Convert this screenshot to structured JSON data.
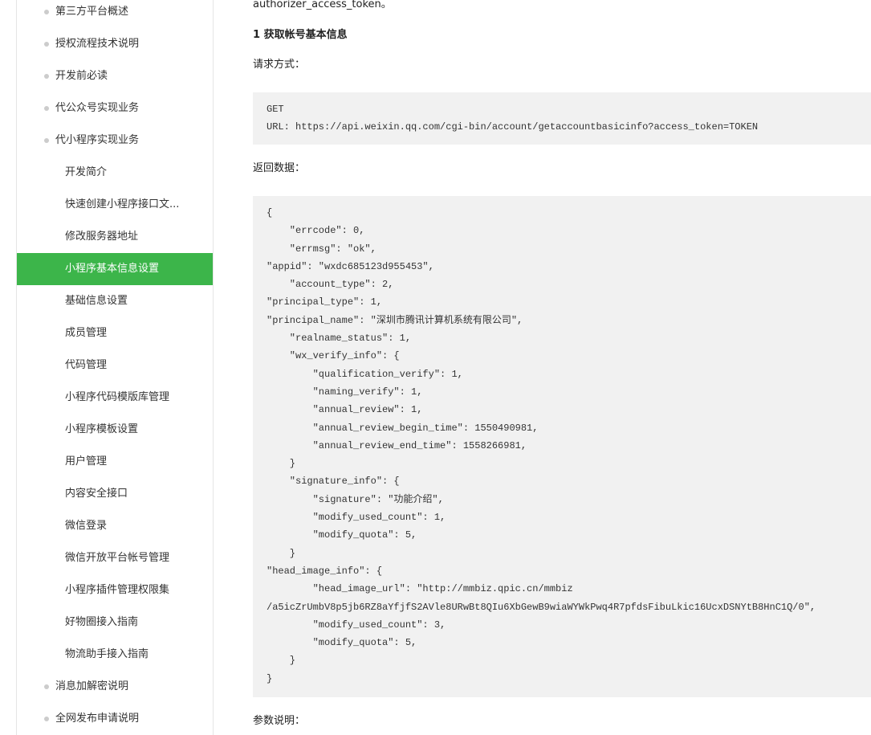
{
  "sidebar": {
    "items": [
      {
        "label": "第三方平台概述",
        "level": "top"
      },
      {
        "label": "授权流程技术说明",
        "level": "top"
      },
      {
        "label": "开发前必读",
        "level": "top"
      },
      {
        "label": "代公众号实现业务",
        "level": "top"
      },
      {
        "label": "代小程序实现业务",
        "level": "top"
      },
      {
        "label": "开发简介",
        "level": "sub"
      },
      {
        "label": "快速创建小程序接口文...",
        "level": "sub"
      },
      {
        "label": "修改服务器地址",
        "level": "sub"
      },
      {
        "label": "小程序基本信息设置",
        "level": "sub",
        "active": true
      },
      {
        "label": "基础信息设置",
        "level": "sub"
      },
      {
        "label": "成员管理",
        "level": "sub"
      },
      {
        "label": "代码管理",
        "level": "sub"
      },
      {
        "label": "小程序代码模版库管理",
        "level": "sub"
      },
      {
        "label": "小程序模板设置",
        "level": "sub"
      },
      {
        "label": "用户管理",
        "level": "sub"
      },
      {
        "label": "内容安全接口",
        "level": "sub"
      },
      {
        "label": "微信登录",
        "level": "sub"
      },
      {
        "label": "微信开放平台帐号管理",
        "level": "sub"
      },
      {
        "label": "小程序插件管理权限集",
        "level": "sub"
      },
      {
        "label": "好物圈接入指南",
        "level": "sub"
      },
      {
        "label": "物流助手接入指南",
        "level": "sub"
      },
      {
        "label": "消息加解密说明",
        "level": "top"
      },
      {
        "label": "全网发布申请说明",
        "level": "top"
      }
    ]
  },
  "content": {
    "intro_tail": "authorizer_access_token。",
    "section_title": "1 获取帐号基本信息",
    "request_label": "请求方式：",
    "request_lines": [
      "GET",
      "URL: https://api.weixin.qq.com/cgi-bin/account/getaccountbasicinfo?access_token=TOKEN"
    ],
    "response_label": "返回数据：",
    "response_lines": [
      "{",
      "    ″errcode″: 0,",
      "    ″errmsg″: ″ok″,",
      "″appid″: ″wxdc685123d955453″,",
      "    ″account_type″: 2,",
      "″principal_type″: 1,",
      "″principal_name″: ″深圳市腾讯计算机系统有限公司″,",
      "    ″realname_status″: 1,",
      "    ″wx_verify_info″: {",
      "        ″qualification_verify″: 1,",
      "        ″naming_verify″: 1,",
      "        ″annual_review″: 1,",
      "        ″annual_review_begin_time″: 1550490981,",
      "        ″annual_review_end_time″: 1558266981,",
      "    }",
      "    ″signature_info″: {",
      "        ″signature″: ″功能介绍″,",
      "        ″modify_used_count″: 1,",
      "        ″modify_quota″: 5,",
      "    }",
      "″head_image_info″: {",
      "        ″head_image_url″: ″http://mmbiz.qpic.cn/mmbiz",
      "/a5icZrUmbV8p5jb6RZ8aYfjfS2AVle8URwBt8QIu6XbGewB9wiaWYWkPwq4R7pfdsFibuLkic16UcxDSNYtB8HnC1Q/0″,",
      "        ″modify_used_count″: 3,",
      "        ″modify_quota″: 5,",
      "    }",
      "}"
    ],
    "params_label": "参数说明："
  }
}
